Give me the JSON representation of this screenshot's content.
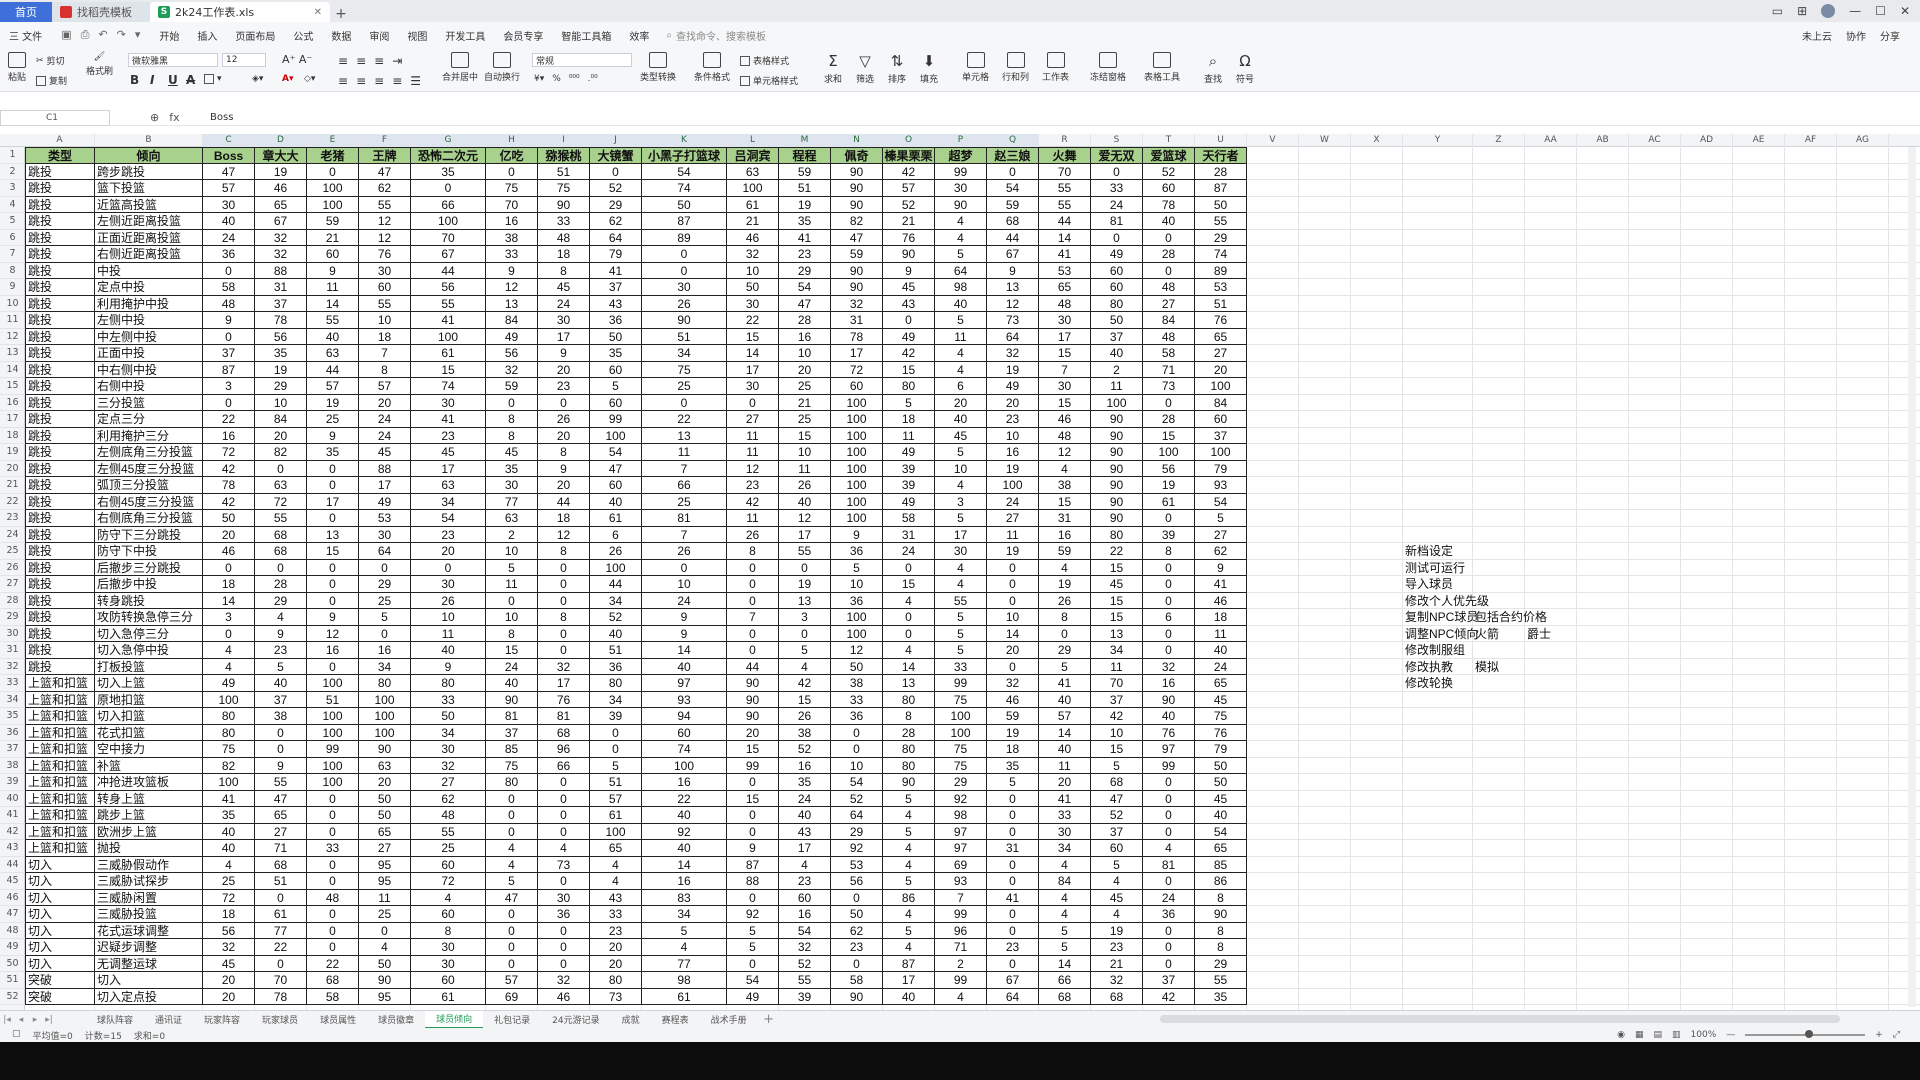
{
  "window": {
    "tabs": [
      {
        "label": "首页"
      },
      {
        "label": "找稻壳模板"
      },
      {
        "label": "2k24工作表.xls"
      }
    ]
  },
  "menu": {
    "file": "三 文件",
    "items": [
      "开始",
      "插入",
      "页面布局",
      "公式",
      "数据",
      "审阅",
      "视图",
      "开发工具",
      "会员专享",
      "智能工具箱",
      "效率"
    ],
    "active": "开始",
    "search": "查找命令、搜索模板",
    "right": [
      "未上云",
      "协作",
      "分享"
    ]
  },
  "ribbon": {
    "paste": "粘贴",
    "cut": "剪切",
    "copy": "复制",
    "format_painter": "格式刷",
    "font": "微软雅黑",
    "font_size": "12",
    "merge": "合并居中",
    "wrap": "自动换行",
    "number_format": "常规",
    "convert": "类型转换",
    "cond_format": "条件格式",
    "table_style": "表格样式",
    "cell_style": "单元格样式",
    "sum": "求和",
    "filter": "筛选",
    "sort": "排序",
    "fill": "填充",
    "cells": "单元格",
    "rowcol": "行和列",
    "sheet": "工作表",
    "freeze": "冻结窗格",
    "tools": "表格工具",
    "find": "查找",
    "symbol": "符号"
  },
  "formula_bar": {
    "cell": "C1",
    "fx": "fx",
    "value": "Boss"
  },
  "columns": [
    "A",
    "B",
    "C",
    "D",
    "E",
    "F",
    "G",
    "H",
    "I",
    "J",
    "K",
    "L",
    "M",
    "N",
    "O",
    "P",
    "Q",
    "R",
    "S",
    "T",
    "U",
    "V",
    "W",
    "X",
    "Y",
    "Z",
    "AA",
    "AB",
    "AC",
    "AD",
    "AE",
    "AF",
    "AG"
  ],
  "table": {
    "headers": [
      "类型",
      "倾向",
      "Boss",
      "章大大",
      "老猪",
      "王牌",
      "恐怖二次元",
      "亿吃",
      "猕猴桃",
      "大镜蟹",
      "小黑子打篮球",
      "吕洞宾",
      "程程",
      "佩奇",
      "榛果栗栗",
      "超梦",
      "赵三娘",
      "火舞",
      "爱无双",
      "爱篮球",
      "天行者"
    ],
    "rows": [
      [
        "跳投",
        "跨步跳投",
        "47",
        "19",
        "0",
        "47",
        "35",
        "0",
        "51",
        "0",
        "54",
        "63",
        "59",
        "90",
        "42",
        "99",
        "0",
        "70",
        "0",
        "52",
        "28"
      ],
      [
        "跳投",
        "篮下投篮",
        "57",
        "46",
        "100",
        "62",
        "0",
        "75",
        "75",
        "52",
        "74",
        "100",
        "51",
        "90",
        "57",
        "30",
        "54",
        "55",
        "33",
        "60",
        "87"
      ],
      [
        "跳投",
        "近篮高投篮",
        "30",
        "65",
        "100",
        "55",
        "66",
        "70",
        "90",
        "29",
        "50",
        "61",
        "19",
        "90",
        "52",
        "90",
        "59",
        "55",
        "24",
        "78",
        "50"
      ],
      [
        "跳投",
        "左侧近距离投篮",
        "40",
        "67",
        "59",
        "12",
        "100",
        "16",
        "33",
        "62",
        "87",
        "21",
        "35",
        "82",
        "21",
        "4",
        "68",
        "44",
        "81",
        "40",
        "55"
      ],
      [
        "跳投",
        "正面近距离投篮",
        "24",
        "32",
        "21",
        "12",
        "70",
        "38",
        "48",
        "64",
        "89",
        "46",
        "41",
        "47",
        "76",
        "4",
        "44",
        "14",
        "0",
        "0",
        "29"
      ],
      [
        "跳投",
        "右侧近距离投篮",
        "36",
        "32",
        "60",
        "76",
        "67",
        "33",
        "18",
        "79",
        "0",
        "32",
        "23",
        "59",
        "90",
        "5",
        "67",
        "41",
        "49",
        "28",
        "74"
      ],
      [
        "跳投",
        "中投",
        "0",
        "88",
        "9",
        "30",
        "44",
        "9",
        "8",
        "41",
        "0",
        "10",
        "29",
        "90",
        "9",
        "64",
        "9",
        "53",
        "60",
        "0",
        "89"
      ],
      [
        "跳投",
        "定点中投",
        "58",
        "31",
        "11",
        "60",
        "56",
        "12",
        "45",
        "37",
        "30",
        "50",
        "54",
        "90",
        "45",
        "98",
        "13",
        "65",
        "60",
        "48",
        "53"
      ],
      [
        "跳投",
        "利用掩护中投",
        "48",
        "37",
        "14",
        "55",
        "55",
        "13",
        "24",
        "43",
        "26",
        "30",
        "47",
        "32",
        "43",
        "40",
        "12",
        "48",
        "80",
        "27",
        "51"
      ],
      [
        "跳投",
        "左侧中投",
        "9",
        "78",
        "55",
        "10",
        "41",
        "84",
        "30",
        "36",
        "90",
        "22",
        "28",
        "31",
        "0",
        "5",
        "73",
        "30",
        "50",
        "84",
        "76"
      ],
      [
        "跳投",
        "中左侧中投",
        "0",
        "56",
        "40",
        "18",
        "100",
        "49",
        "17",
        "50",
        "51",
        "15",
        "16",
        "78",
        "49",
        "11",
        "64",
        "17",
        "37",
        "48",
        "65"
      ],
      [
        "跳投",
        "正面中投",
        "37",
        "35",
        "63",
        "7",
        "61",
        "56",
        "9",
        "35",
        "34",
        "14",
        "10",
        "17",
        "42",
        "4",
        "32",
        "15",
        "40",
        "58",
        "27"
      ],
      [
        "跳投",
        "中右侧中投",
        "87",
        "19",
        "44",
        "8",
        "15",
        "32",
        "20",
        "60",
        "75",
        "17",
        "20",
        "72",
        "15",
        "4",
        "19",
        "7",
        "2",
        "71",
        "20"
      ],
      [
        "跳投",
        "右侧中投",
        "3",
        "29",
        "57",
        "57",
        "74",
        "59",
        "23",
        "5",
        "25",
        "30",
        "25",
        "60",
        "80",
        "6",
        "49",
        "30",
        "11",
        "73",
        "100"
      ],
      [
        "跳投",
        "三分投篮",
        "0",
        "10",
        "19",
        "20",
        "30",
        "0",
        "0",
        "60",
        "0",
        "0",
        "21",
        "100",
        "5",
        "20",
        "20",
        "15",
        "100",
        "0",
        "84"
      ],
      [
        "跳投",
        "定点三分",
        "22",
        "84",
        "25",
        "24",
        "41",
        "8",
        "26",
        "99",
        "22",
        "27",
        "25",
        "100",
        "18",
        "40",
        "23",
        "46",
        "90",
        "28",
        "60"
      ],
      [
        "跳投",
        "利用掩护三分",
        "16",
        "20",
        "9",
        "24",
        "23",
        "8",
        "20",
        "100",
        "13",
        "11",
        "15",
        "100",
        "11",
        "45",
        "10",
        "48",
        "90",
        "15",
        "37"
      ],
      [
        "跳投",
        "左侧底角三分投篮",
        "72",
        "82",
        "35",
        "45",
        "45",
        "45",
        "8",
        "54",
        "11",
        "11",
        "10",
        "100",
        "49",
        "5",
        "16",
        "12",
        "90",
        "100",
        "100"
      ],
      [
        "跳投",
        "左侧45度三分投篮",
        "42",
        "0",
        "0",
        "88",
        "17",
        "35",
        "9",
        "47",
        "7",
        "12",
        "11",
        "100",
        "39",
        "10",
        "19",
        "4",
        "90",
        "56",
        "79"
      ],
      [
        "跳投",
        "弧顶三分投篮",
        "78",
        "63",
        "0",
        "17",
        "63",
        "30",
        "20",
        "60",
        "66",
        "23",
        "26",
        "100",
        "39",
        "4",
        "100",
        "38",
        "90",
        "19",
        "93"
      ],
      [
        "跳投",
        "右侧45度三分投篮",
        "42",
        "72",
        "17",
        "49",
        "34",
        "77",
        "44",
        "40",
        "25",
        "42",
        "40",
        "100",
        "49",
        "3",
        "24",
        "15",
        "90",
        "61",
        "54"
      ],
      [
        "跳投",
        "右侧底角三分投篮",
        "50",
        "55",
        "0",
        "53",
        "54",
        "63",
        "18",
        "61",
        "81",
        "11",
        "12",
        "100",
        "58",
        "5",
        "27",
        "31",
        "90",
        "0",
        "5"
      ],
      [
        "跳投",
        "防守下三分跳投",
        "20",
        "68",
        "13",
        "30",
        "23",
        "2",
        "12",
        "6",
        "7",
        "26",
        "17",
        "9",
        "31",
        "17",
        "11",
        "16",
        "80",
        "39",
        "27"
      ],
      [
        "跳投",
        "防守下中投",
        "46",
        "68",
        "15",
        "64",
        "20",
        "10",
        "8",
        "26",
        "26",
        "8",
        "55",
        "36",
        "24",
        "30",
        "19",
        "59",
        "22",
        "8",
        "62"
      ],
      [
        "跳投",
        "后撤步三分跳投",
        "0",
        "0",
        "0",
        "0",
        "0",
        "5",
        "0",
        "100",
        "0",
        "0",
        "0",
        "5",
        "0",
        "4",
        "0",
        "4",
        "15",
        "0",
        "9"
      ],
      [
        "跳投",
        "后撤步中投",
        "18",
        "28",
        "0",
        "29",
        "30",
        "11",
        "0",
        "44",
        "10",
        "0",
        "19",
        "10",
        "15",
        "4",
        "0",
        "19",
        "45",
        "0",
        "41"
      ],
      [
        "跳投",
        "转身跳投",
        "14",
        "29",
        "0",
        "25",
        "26",
        "0",
        "0",
        "34",
        "24",
        "0",
        "13",
        "36",
        "4",
        "55",
        "0",
        "26",
        "15",
        "0",
        "46"
      ],
      [
        "跳投",
        "攻防转换急停三分",
        "3",
        "4",
        "9",
        "5",
        "10",
        "10",
        "8",
        "52",
        "9",
        "7",
        "3",
        "100",
        "0",
        "5",
        "10",
        "8",
        "15",
        "6",
        "18"
      ],
      [
        "跳投",
        "切入急停三分",
        "0",
        "9",
        "12",
        "0",
        "11",
        "8",
        "0",
        "40",
        "9",
        "0",
        "0",
        "100",
        "0",
        "5",
        "14",
        "0",
        "13",
        "0",
        "11"
      ],
      [
        "跳投",
        "切入急停中投",
        "4",
        "23",
        "16",
        "16",
        "40",
        "15",
        "0",
        "51",
        "14",
        "0",
        "5",
        "12",
        "4",
        "5",
        "20",
        "29",
        "34",
        "0",
        "40"
      ],
      [
        "跳投",
        "打板投篮",
        "4",
        "5",
        "0",
        "34",
        "9",
        "24",
        "32",
        "36",
        "40",
        "44",
        "4",
        "50",
        "14",
        "33",
        "0",
        "5",
        "11",
        "32",
        "24"
      ],
      [
        "上篮和扣篮",
        "切入上篮",
        "49",
        "40",
        "100",
        "80",
        "80",
        "40",
        "17",
        "80",
        "97",
        "90",
        "42",
        "38",
        "13",
        "99",
        "32",
        "41",
        "70",
        "16",
        "65"
      ],
      [
        "上篮和扣篮",
        "原地扣篮",
        "100",
        "37",
        "51",
        "100",
        "33",
        "90",
        "76",
        "34",
        "93",
        "90",
        "15",
        "33",
        "80",
        "75",
        "46",
        "40",
        "37",
        "90",
        "45"
      ],
      [
        "上篮和扣篮",
        "切入扣篮",
        "80",
        "38",
        "100",
        "100",
        "50",
        "81",
        "81",
        "39",
        "94",
        "90",
        "26",
        "36",
        "8",
        "100",
        "59",
        "57",
        "42",
        "40",
        "75"
      ],
      [
        "上篮和扣篮",
        "花式扣篮",
        "80",
        "0",
        "100",
        "100",
        "34",
        "37",
        "68",
        "0",
        "60",
        "20",
        "38",
        "0",
        "28",
        "100",
        "19",
        "14",
        "10",
        "76",
        "76"
      ],
      [
        "上篮和扣篮",
        "空中接力",
        "75",
        "0",
        "99",
        "90",
        "30",
        "85",
        "96",
        "0",
        "74",
        "15",
        "52",
        "0",
        "80",
        "75",
        "18",
        "40",
        "15",
        "97",
        "79"
      ],
      [
        "上篮和扣篮",
        "补篮",
        "82",
        "9",
        "100",
        "63",
        "32",
        "75",
        "66",
        "5",
        "100",
        "99",
        "16",
        "10",
        "80",
        "75",
        "35",
        "11",
        "5",
        "99",
        "50"
      ],
      [
        "上篮和扣篮",
        "冲抢进攻篮板",
        "100",
        "55",
        "100",
        "20",
        "27",
        "80",
        "0",
        "51",
        "16",
        "0",
        "35",
        "54",
        "90",
        "29",
        "5",
        "20",
        "68",
        "0",
        "50"
      ],
      [
        "上篮和扣篮",
        "转身上篮",
        "41",
        "47",
        "0",
        "50",
        "62",
        "0",
        "0",
        "57",
        "22",
        "15",
        "24",
        "52",
        "5",
        "92",
        "0",
        "41",
        "47",
        "0",
        "45"
      ],
      [
        "上篮和扣篮",
        "跳步上篮",
        "35",
        "65",
        "0",
        "50",
        "48",
        "0",
        "0",
        "61",
        "40",
        "0",
        "40",
        "64",
        "4",
        "98",
        "0",
        "33",
        "52",
        "0",
        "40"
      ],
      [
        "上篮和扣篮",
        "欧洲步上篮",
        "40",
        "27",
        "0",
        "65",
        "55",
        "0",
        "0",
        "100",
        "92",
        "0",
        "43",
        "29",
        "5",
        "97",
        "0",
        "30",
        "37",
        "0",
        "54"
      ],
      [
        "上篮和扣篮",
        "抛投",
        "40",
        "71",
        "33",
        "27",
        "25",
        "4",
        "4",
        "65",
        "40",
        "9",
        "17",
        "92",
        "4",
        "97",
        "31",
        "34",
        "60",
        "4",
        "65"
      ],
      [
        "切入",
        "三威胁假动作",
        "4",
        "68",
        "0",
        "95",
        "60",
        "4",
        "73",
        "4",
        "14",
        "87",
        "4",
        "53",
        "4",
        "69",
        "0",
        "4",
        "5",
        "81",
        "85"
      ],
      [
        "切入",
        "三威胁试探步",
        "25",
        "51",
        "0",
        "95",
        "72",
        "5",
        "0",
        "4",
        "16",
        "88",
        "23",
        "56",
        "5",
        "93",
        "0",
        "84",
        "4",
        "0",
        "86"
      ],
      [
        "切入",
        "三威胁闲置",
        "72",
        "0",
        "48",
        "11",
        "4",
        "47",
        "30",
        "43",
        "83",
        "0",
        "60",
        "0",
        "86",
        "7",
        "41",
        "4",
        "45",
        "24",
        "8"
      ],
      [
        "切入",
        "三威胁投篮",
        "18",
        "61",
        "0",
        "25",
        "60",
        "0",
        "36",
        "33",
        "34",
        "92",
        "16",
        "50",
        "4",
        "99",
        "0",
        "4",
        "4",
        "36",
        "90"
      ],
      [
        "切入",
        "花式运球调整",
        "56",
        "77",
        "0",
        "0",
        "8",
        "0",
        "0",
        "23",
        "5",
        "5",
        "54",
        "62",
        "5",
        "96",
        "0",
        "5",
        "19",
        "0",
        "8"
      ],
      [
        "切入",
        "迟疑步调整",
        "32",
        "22",
        "0",
        "4",
        "30",
        "0",
        "0",
        "20",
        "4",
        "5",
        "32",
        "23",
        "4",
        "71",
        "23",
        "5",
        "23",
        "0",
        "8"
      ],
      [
        "切入",
        "无调整运球",
        "45",
        "0",
        "22",
        "50",
        "30",
        "0",
        "0",
        "20",
        "77",
        "0",
        "52",
        "0",
        "87",
        "2",
        "0",
        "14",
        "21",
        "0",
        "29"
      ],
      [
        "突破",
        "切入",
        "20",
        "70",
        "68",
        "90",
        "60",
        "57",
        "32",
        "80",
        "98",
        "54",
        "55",
        "58",
        "17",
        "99",
        "67",
        "66",
        "32",
        "37",
        "55"
      ],
      [
        "突破",
        "切入定点投",
        "20",
        "78",
        "58",
        "95",
        "61",
        "69",
        "46",
        "73",
        "61",
        "49",
        "39",
        "90",
        "40",
        "4",
        "64",
        "68",
        "68",
        "42",
        "35"
      ]
    ]
  },
  "side_notes": [
    [
      "新档设定"
    ],
    [
      "测试可运行"
    ],
    [
      "导入球员"
    ],
    [
      "修改个人优先级"
    ],
    [
      "复制NPC球员",
      "包括合约价格"
    ],
    [
      "调整NPC倾向",
      "火箭",
      "爵士"
    ],
    [
      "修改制服组"
    ],
    [
      "修改执教",
      "模拟"
    ],
    [
      "修改轮换"
    ]
  ],
  "sheet_tabs": [
    "球队阵容",
    "通讯证",
    "玩家阵容",
    "玩家球员",
    "球员属性",
    "球员徽章",
    "球员倾向",
    "礼包记录",
    "24元游记录",
    "成就",
    "赛程表",
    "战术手册"
  ],
  "active_sheet": "球员倾向",
  "status": {
    "left": [
      "平均值=0",
      "计数=15",
      "求和=0"
    ],
    "zoom": "100%"
  }
}
